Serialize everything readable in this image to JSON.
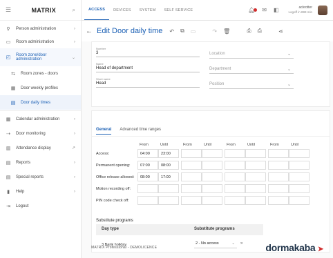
{
  "sidebar": {
    "brand": "MATRIX",
    "items": [
      {
        "icon": "person-icon",
        "label": "Person administration",
        "arrow": "›"
      },
      {
        "icon": "room-icon",
        "label": "Room administration",
        "arrow": "›"
      },
      {
        "icon": "room-zone-icon",
        "label": "Room zone/door administration",
        "arrow": "⌄"
      },
      {
        "icon": "room-zones-doors-icon",
        "label": "Room zones - doors"
      },
      {
        "icon": "door-profiles-icon",
        "label": "Door weekly profiles"
      },
      {
        "icon": "door-daily-icon",
        "label": "Door daily times"
      },
      {
        "icon": "calendar-icon",
        "label": "Calendar administration",
        "arrow": "›"
      },
      {
        "icon": "door-monitoring-icon",
        "label": "Door monitoring",
        "arrow": "›"
      },
      {
        "icon": "attendance-icon",
        "label": "Attendance display",
        "arrow": "↗"
      },
      {
        "icon": "reports-icon",
        "label": "Reports",
        "arrow": "›"
      },
      {
        "icon": "special-reports-icon",
        "label": "Special reports",
        "arrow": "›"
      },
      {
        "icon": "help-icon",
        "label": "Help",
        "arrow": "›"
      },
      {
        "icon": "logout-icon",
        "label": "Logout"
      }
    ]
  },
  "topbar": {
    "tabs": [
      "ACCESS",
      "DEVICES",
      "SYSTEM",
      "SELF SERVICE"
    ],
    "user_name": "ackrotter",
    "user_sub": "Logoff in 899 min"
  },
  "page": {
    "title": "Edit Door daily time"
  },
  "form": {
    "number_label": "Number",
    "number_value": "3",
    "name_label": "Name",
    "name_value": "Head of department",
    "short_label": "Short name",
    "short_value": "Head",
    "location": "Location",
    "department": "Department",
    "position": "Position"
  },
  "time_ranges": {
    "tabs": [
      "General",
      "Advanced time ranges"
    ],
    "col_from": "From",
    "col_until": "Until",
    "rows": [
      {
        "label": "Access:",
        "values": [
          "04:00",
          "23:00"
        ]
      },
      {
        "label": "Permanent opening:",
        "values": [
          "07:00",
          "08:00"
        ]
      },
      {
        "label": "Office release allowed:",
        "values": [
          "08:00",
          "17:00"
        ]
      },
      {
        "label": "Motion recording off:",
        "values": [
          "",
          ""
        ]
      },
      {
        "label": "PIN code check off:",
        "values": [
          "",
          ""
        ]
      }
    ]
  },
  "substitute": {
    "title": "Substitute programs",
    "col_day": "Day type",
    "col_prog": "Substitute programs",
    "row_day": "3 Bank holiday",
    "row_value": "2 - No access"
  },
  "footer": {
    "text": "MATRIX Professional - DEMOLICENCE",
    "logo": "dormakaba"
  }
}
